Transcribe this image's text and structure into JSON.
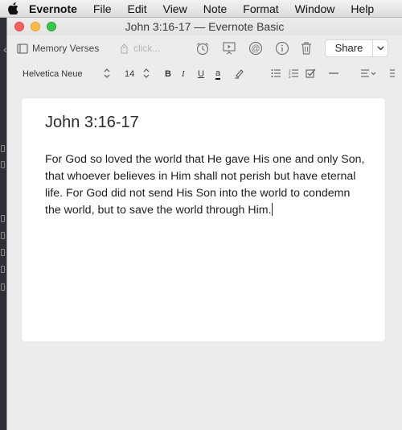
{
  "menubar": {
    "app_name": "Evernote",
    "items": [
      "File",
      "Edit",
      "View",
      "Note",
      "Format",
      "Window",
      "Help"
    ]
  },
  "window": {
    "title": "John 3:16-17 — Evernote Basic"
  },
  "toolbar": {
    "notebook": "Memory Verses",
    "tags_placeholder": "click...",
    "share_label": "Share",
    "icons": [
      "reminder-icon",
      "presentation-icon",
      "at-sign-icon",
      "info-icon",
      "trash-icon"
    ]
  },
  "format_bar": {
    "font_family": "Helvetica Neue",
    "font_size": "14",
    "bold": "B",
    "italic": "I",
    "underline": "U",
    "text_color": "a"
  },
  "note": {
    "title": "John 3:16-17",
    "body": "For God so loved the world that He gave His one and only Son, that whoever believes in Him shall not perish but have eternal life. For God did not send His Son into the world to condemn the world, but to save the world through Him."
  },
  "colors": {
    "close": "#fc605c",
    "minimize": "#fdbc40",
    "maximize": "#34c84a"
  }
}
